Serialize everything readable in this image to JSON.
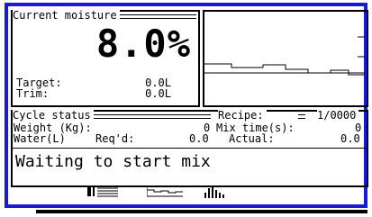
{
  "moisture": {
    "title": "Current moisture",
    "value": "8.0%",
    "target_label": "Target:",
    "target_value": "0.0L",
    "trim_label": "Trim:",
    "trim_value": "0.0L"
  },
  "cycle": {
    "title": "Cycle status",
    "recipe_label": "Recipe:",
    "recipe_value": "1/0000",
    "weight_label": "Weight (Kg):",
    "weight_value": "0",
    "mix_time_label": "Mix time(s):",
    "mix_time_value": "0",
    "water_label": "Water(L)",
    "reqd_label": "Req'd:",
    "reqd_value": "0.0",
    "actual_label": "Actual:",
    "actual_value": "0.0",
    "status_message": "Waiting to start mix"
  },
  "softkeys": [
    {
      "icon": "list-icon"
    },
    {
      "icon": "trend-line-icon"
    },
    {
      "icon": "bar-chart-icon"
    }
  ],
  "colors": {
    "frame": "#1a1ad6",
    "background": "#ffffff",
    "text": "#000000"
  }
}
